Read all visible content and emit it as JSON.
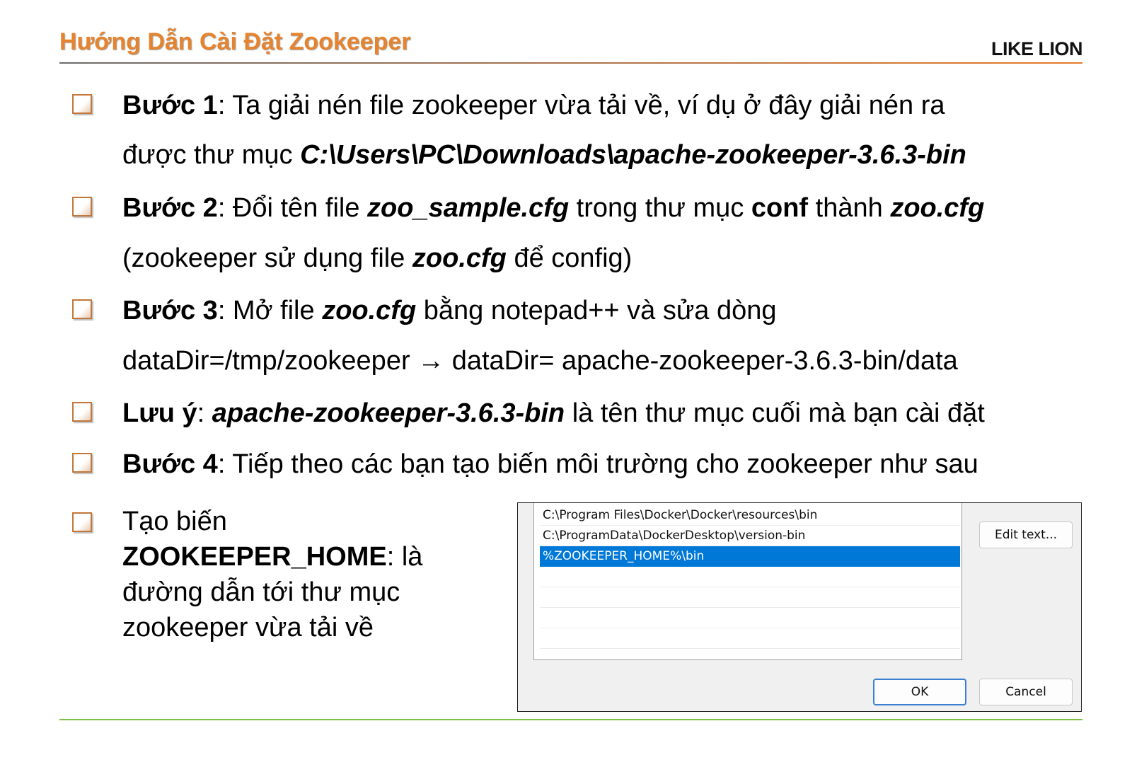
{
  "header": {
    "title": "Hướng Dẫn Cài Đặt Zookeeper",
    "brand": "LIKE LION"
  },
  "steps": {
    "step1": {
      "label": "Bước 1",
      "text_a": ": Ta giải nén file zookeeper vừa tải về, ví dụ ở đây giải nén ra",
      "text_b": "được thư mục ",
      "path": "C:\\Users\\PC\\Downloads\\apache-zookeeper-3.6.3-bin"
    },
    "step2": {
      "label": "Bước 2",
      "text_a": ": Đổi tên file ",
      "file_from": "zoo_sample.cfg",
      "text_b": " trong thư mục ",
      "folder": "conf",
      "text_c": " thành ",
      "file_to": "zoo.cfg",
      "text_d": "(zookeeper sử dụng file ",
      "file_cfg": "zoo.cfg",
      "text_e": " để config)"
    },
    "step3": {
      "label": "Bước 3",
      "text_a": ": Mở file ",
      "file": "zoo.cfg",
      "text_b": " bằng notepad++ và sửa dòng",
      "text_c": "dataDir=/tmp/zookeeper → dataDir= apache-zookeeper-3.6.3-bin/data"
    },
    "note": {
      "label": "Lưu ý",
      "text_a": ": ",
      "folder": "apache-zookeeper-3.6.3-bin",
      "text_b": " là tên thư mục cuối mà bạn cài đặt"
    },
    "step4": {
      "label": "Bước 4",
      "text_a": ": Tiếp theo các bạn tạo biến môi trường cho zookeeper như sau"
    },
    "create_var": {
      "text_a": "Tạo biến ",
      "var": "ZOOKEEPER_HOME",
      "text_b": ": là đường dẫn tới thư mục zookeeper vừa tải về"
    }
  },
  "dialog": {
    "rows": [
      "C:\\Program Files\\Docker\\Docker\\resources\\bin",
      "C:\\ProgramData\\DockerDesktop\\version-bin",
      "%ZOOKEEPER_HOME%\\bin"
    ],
    "edit_text_label": "Edit text...",
    "ok_label": "OK",
    "cancel_label": "Cancel"
  }
}
